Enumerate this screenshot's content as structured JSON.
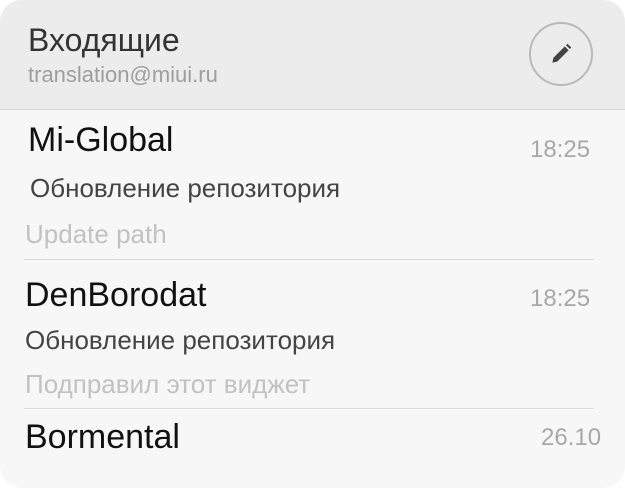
{
  "header": {
    "title": "Входящие",
    "account": "translation@miui.ru",
    "compose_icon": "pencil-icon"
  },
  "messages": [
    {
      "sender": "Mi-Global",
      "time": "18:25",
      "subject": "Обновление репозитория",
      "preview": "Update path"
    },
    {
      "sender": "DenBorodat",
      "time": "18:25",
      "subject": "Обновление репозитория",
      "preview": "Подправил этот виджет"
    },
    {
      "sender": "Bormental",
      "time": "26.10"
    }
  ],
  "colors": {
    "header_bg": "#ececec",
    "list_bg": "#f7f7f7",
    "sender": "#111111",
    "subject": "#444444",
    "preview": "#c2c2c2",
    "time": "#a8a8a8"
  }
}
